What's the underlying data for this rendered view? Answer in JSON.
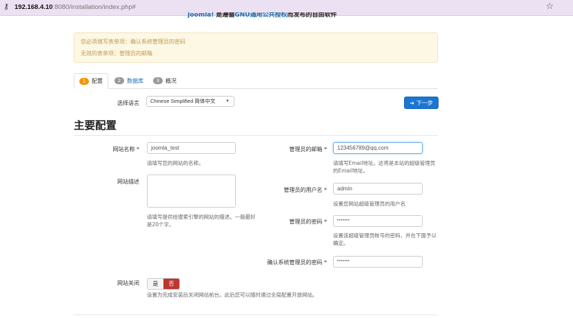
{
  "browser": {
    "url_host": "192.168.4.10",
    "url_rest": ":8080/installation/index.php#"
  },
  "top_banner": {
    "product": "Joomla!",
    "text_a": "是遵循",
    "license": "GNU通用公共授权",
    "text_b": "而发布的自由软件"
  },
  "alert": {
    "line1": "您必须填写表单项：确认系统管理员的密码",
    "line2": "无效的表单项：管理员的邮箱"
  },
  "tabs": [
    {
      "num": "1",
      "label": "配置"
    },
    {
      "num": "2",
      "label": "数据库"
    },
    {
      "num": "3",
      "label": "概况"
    }
  ],
  "language": {
    "label": "选择语言",
    "selected": "Chinese Simplified 简体中文"
  },
  "next_button": "下一步",
  "main_title": "主要配置",
  "fields": {
    "site_name": {
      "label": "网站名称 *",
      "value": "joomla_test",
      "help": "请填写您的网站的名称。"
    },
    "site_desc": {
      "label": "网站描述",
      "value": "",
      "help": "请填写提供给搜索引擎的网站的描述。一般最好是20个字。"
    },
    "admin_email": {
      "label": "管理员的邮箱 *",
      "value": "123456789@qq.com",
      "help": "请填写Email地址。这将是本站的超级管理员的Email地址。"
    },
    "admin_user": {
      "label": "管理员的用户名 *",
      "value": "admin",
      "help": "设置您网站超级管理员的用户名"
    },
    "admin_pass": {
      "label": "管理员的密码 *",
      "value": "•••••••",
      "help": "设置该超级管理员帐号的密码，并在下面予以确定。"
    },
    "admin_pass_confirm": {
      "label": "确认系统管理员的密码 *",
      "value": "•••••••"
    },
    "site_offline": {
      "label": "网站关闭",
      "yes": "是",
      "no": "否",
      "selected": "否",
      "help": "设置为完成安装后关闭网站前台。此后您可以随时通过全局配置开放网站。"
    }
  },
  "colors": {
    "primary": "#1a76d2",
    "warning_bg": "#fcf8e3",
    "warning_text": "#c09853",
    "active_badge": "#f89406",
    "toggle_no": "#bd362f"
  },
  "icons": {
    "address_bar": "key-icon",
    "bookmark": "star-icon",
    "next": "arrow-right-icon",
    "select": "caret-down-icon"
  }
}
